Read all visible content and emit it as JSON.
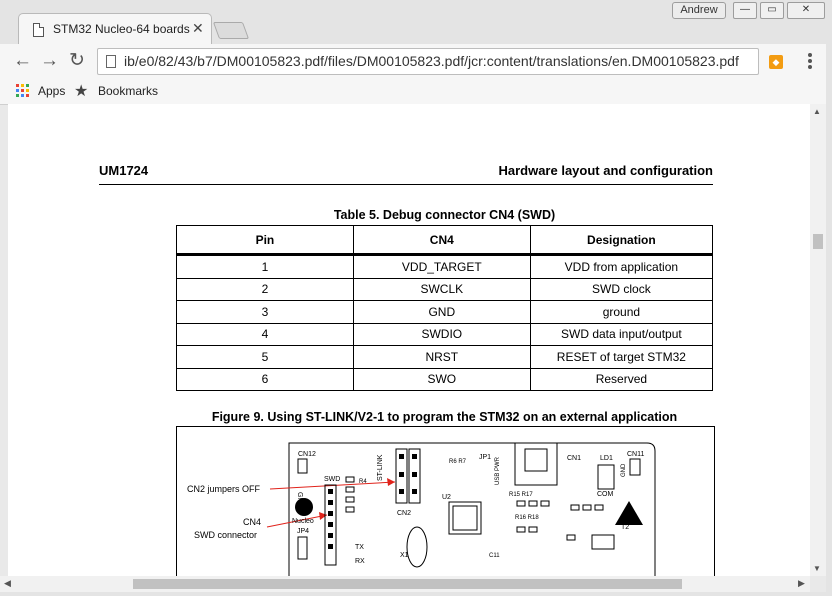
{
  "browser": {
    "tab_title": "STM32 Nucleo-64 boards",
    "user_name": "Andrew",
    "url": "ib/e0/82/43/b7/DM00105823.pdf/files/DM00105823.pdf/jcr:content/translations/en.DM00105823.pdf",
    "bookmarks": {
      "apps": "Apps",
      "bookmarks": "Bookmarks"
    }
  },
  "document": {
    "header_left": "UM1724",
    "header_right": "Hardware layout and configuration",
    "table_caption": "Table 5. Debug connector CN4 (SWD)",
    "table_headers": [
      "Pin",
      "CN4",
      "Designation"
    ],
    "table_rows": [
      [
        "1",
        "VDD_TARGET",
        "VDD from application"
      ],
      [
        "2",
        "SWCLK",
        "SWD clock"
      ],
      [
        "3",
        "GND",
        "ground"
      ],
      [
        "4",
        "SWDIO",
        "SWD data input/output"
      ],
      [
        "5",
        "NRST",
        "RESET of target STM32"
      ],
      [
        "6",
        "SWO",
        "Reserved"
      ]
    ],
    "figure_caption": "Figure 9. Using ST-LINK/V2-1 to program the STM32 on an external application",
    "figure_labels": {
      "cn2_jumpers": "CN2 jumpers OFF",
      "cn4": "CN4",
      "swd_connector": "SWD connector",
      "cn12": "CN12",
      "cn11": "CN11",
      "cn1": "CN1",
      "gnd": "GND",
      "swd": "SWD",
      "nucleo": "Nucleo",
      "st_link": "ST-LINK",
      "jp1": "JP1",
      "usb_pwr": "USB PWR",
      "ld1": "LD1",
      "com": "COM",
      "u2": "U2",
      "x1": "X1",
      "cn2": "CN2",
      "jp4": "JP4",
      "t2": "T2",
      "r4": "R4",
      "r6_r7": "R6 R7",
      "r15_r17": "R15 R17",
      "r16_r18": "R16 R18",
      "tx": "TX",
      "rx": "RX",
      "c11": "C11"
    }
  },
  "colors": {
    "arrow": "#e0231b",
    "page_bg": "#ffffff",
    "chrome_bg": "#e4e4e4"
  },
  "icons": [
    "doc-icon",
    "close-icon",
    "back-icon",
    "forward-icon",
    "reload-icon",
    "page-icon",
    "extension-icon",
    "menu-icon",
    "apps-icon",
    "star-icon"
  ]
}
